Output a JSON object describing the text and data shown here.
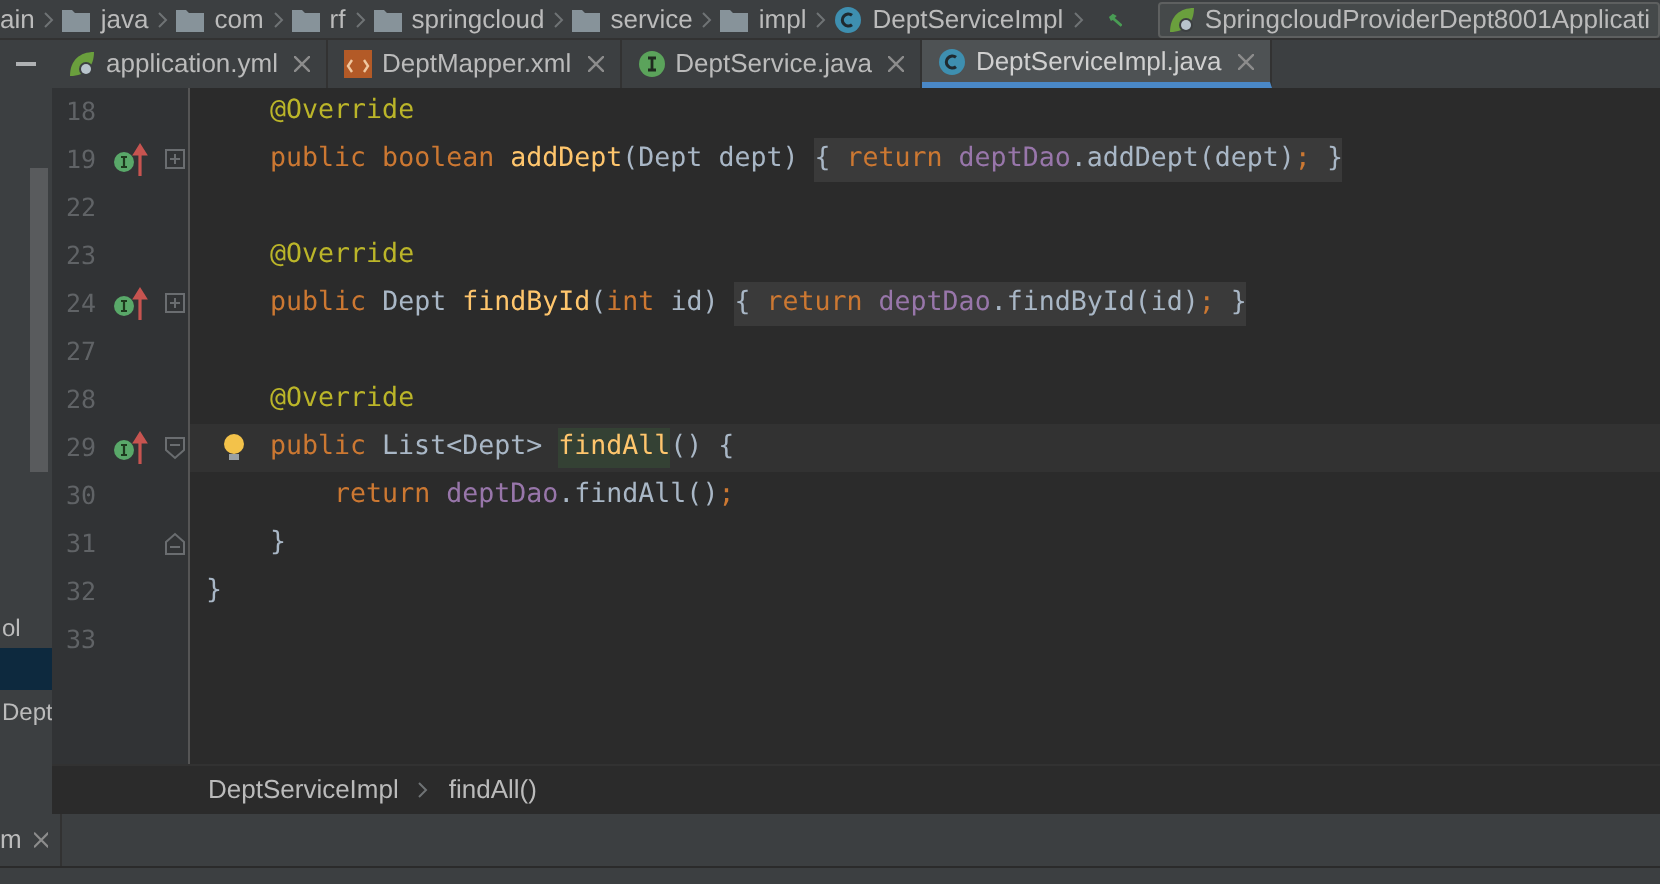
{
  "navigation_bar": {
    "crumbs": [
      {
        "label": "ain",
        "kind": "folder_cut"
      },
      {
        "label": "java",
        "kind": "folder"
      },
      {
        "label": "com",
        "kind": "folder"
      },
      {
        "label": "rf",
        "kind": "folder"
      },
      {
        "label": "springcloud",
        "kind": "folder"
      },
      {
        "label": "service",
        "kind": "folder"
      },
      {
        "label": "impl",
        "kind": "folder"
      },
      {
        "label": "DeptServiceImpl",
        "kind": "class"
      }
    ],
    "run_configuration": "SpringcloudProviderDept8001Applicati"
  },
  "editor_tabs": [
    {
      "label": "application.yml",
      "kind": "yaml",
      "selected": false
    },
    {
      "label": "DeptMapper.xml",
      "kind": "xml",
      "selected": false
    },
    {
      "label": "DeptService.java",
      "kind": "interface",
      "selected": false
    },
    {
      "label": "DeptServiceImpl.java",
      "kind": "class",
      "selected": true
    }
  ],
  "project_panel": {
    "items": [
      {
        "label": "ol",
        "selected": false
      },
      {
        "selected": true
      },
      {
        "label": "Dept",
        "selected": false
      }
    ]
  },
  "code_lines": [
    {
      "number": "18",
      "implements": false,
      "fold_start": false,
      "fold_end": false,
      "caret": false,
      "tokens": [
        {
          "text": "    @Override",
          "kind": "annotation"
        }
      ]
    },
    {
      "number": "19",
      "implements": true,
      "fold_start": false,
      "fold_end": false,
      "caret": false,
      "tokens": [
        {
          "text": "    public boolean ",
          "kind": "keyword"
        },
        {
          "text": "addDept",
          "kind": "method"
        },
        {
          "text": "(Dept dept) ",
          "kind": "plain"
        }
      ],
      "folded": [
        {
          "text": "{ ",
          "kind": "plain"
        },
        {
          "text": "return ",
          "kind": "keyword"
        },
        {
          "text": "deptDao",
          "kind": "field"
        },
        {
          "text": ".addDept(dept)",
          "kind": "plain"
        },
        {
          "text": ";",
          "kind": "keyword"
        },
        {
          "text": " }",
          "kind": "plain"
        }
      ]
    },
    {
      "number": "22",
      "implements": false,
      "fold_start": false,
      "fold_end": false,
      "caret": false
    },
    {
      "number": "23",
      "implements": false,
      "fold_start": false,
      "fold_end": false,
      "caret": false,
      "tokens": [
        {
          "text": "    @Override",
          "kind": "annotation"
        }
      ]
    },
    {
      "number": "24",
      "implements": true,
      "fold_start": false,
      "fold_end": false,
      "caret": false,
      "tokens": [
        {
          "text": "    public ",
          "kind": "keyword"
        },
        {
          "text": "Dept ",
          "kind": "plain"
        },
        {
          "text": "findById",
          "kind": "method"
        },
        {
          "text": "(",
          "kind": "plain"
        },
        {
          "text": "int ",
          "kind": "keyword"
        },
        {
          "text": "id) ",
          "kind": "plain"
        }
      ],
      "folded": [
        {
          "text": "{ ",
          "kind": "plain"
        },
        {
          "text": "return ",
          "kind": "keyword"
        },
        {
          "text": "deptDao",
          "kind": "field"
        },
        {
          "text": ".findById(id)",
          "kind": "plain"
        },
        {
          "text": ";",
          "kind": "keyword"
        },
        {
          "text": " }",
          "kind": "plain"
        }
      ]
    },
    {
      "number": "27",
      "implements": false,
      "fold_start": false,
      "fold_end": false,
      "caret": false
    },
    {
      "number": "28",
      "implements": false,
      "fold_start": false,
      "fold_end": false,
      "caret": false,
      "tokens": [
        {
          "text": "    @Override",
          "kind": "annotation"
        }
      ]
    },
    {
      "number": "29",
      "implements": true,
      "fold_start": true,
      "fold_end": false,
      "caret": true,
      "tokens": [
        {
          "text": "public ",
          "kind": "keyword"
        },
        {
          "text": "List<Dept> ",
          "kind": "plain"
        },
        {
          "text": "findAll",
          "kind": "method_match"
        },
        {
          "text": "() {",
          "kind": "plain"
        }
      ]
    },
    {
      "number": "30",
      "implements": false,
      "fold_start": false,
      "fold_end": false,
      "caret": false,
      "tokens": [
        {
          "text": "        return ",
          "kind": "keyword"
        },
        {
          "text": "deptDao",
          "kind": "field"
        },
        {
          "text": ".findAll()",
          "kind": "plain"
        },
        {
          "text": ";",
          "kind": "keyword"
        }
      ]
    },
    {
      "number": "31",
      "implements": false,
      "fold_start": false,
      "fold_end": true,
      "caret": false,
      "tokens": [
        {
          "text": "    }",
          "kind": "plain"
        }
      ]
    },
    {
      "number": "32",
      "implements": false,
      "fold_start": false,
      "fold_end": false,
      "caret": false,
      "tokens": [
        {
          "text": "}",
          "kind": "plain"
        }
      ]
    },
    {
      "number": "33",
      "implements": false,
      "fold_start": false,
      "fold_end": false,
      "caret": false
    }
  ],
  "breadcrumbs": [
    "DeptServiceImpl",
    "findAll()"
  ],
  "bottom_tabs": [
    {
      "label": "m",
      "closable": true
    }
  ]
}
